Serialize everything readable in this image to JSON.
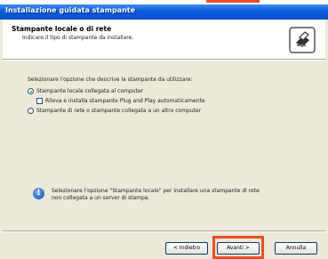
{
  "window": {
    "title": "Installazione guidata stampante"
  },
  "header": {
    "title": "Stampante locale o di rete",
    "subtitle": "Indicare il tipo di stampante da installare.",
    "icon": "printer-icon"
  },
  "body": {
    "prompt": "Selezionare l'opzione che descrive la stampante da utilizzare:",
    "options": [
      {
        "label": "Stampante locale collegata al computer",
        "selected": true
      },
      {
        "label": "Rileva e installa stampante Plug and Play automaticamente",
        "checked": false
      },
      {
        "label": "Stampante di rete o stampante collegata a un altro computer",
        "selected": false
      }
    ],
    "info_line1": "Selezionare l'opzione \"Stampante locale\" per installare una stampante di rete",
    "info_line2": "non collegata a un server di stampa."
  },
  "buttons": {
    "back": "< Indietro",
    "next": "Avanti >",
    "cancel": "Annulla"
  },
  "colors": {
    "highlight": "#f04d1e",
    "titlebar": "#0a5cdb"
  }
}
